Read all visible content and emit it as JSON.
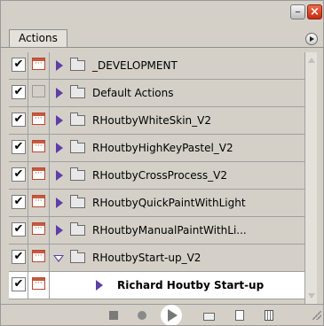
{
  "panel": {
    "tab_label": "Actions",
    "rows": [
      {
        "name": "_DEVELOPMENT",
        "checked": true,
        "dialog": true,
        "expanded": false,
        "kind": "set"
      },
      {
        "name": "Default Actions",
        "checked": true,
        "dialog": false,
        "expanded": false,
        "kind": "set"
      },
      {
        "name": "RHoutbyWhiteSkin_V2",
        "checked": true,
        "dialog": true,
        "expanded": false,
        "kind": "set"
      },
      {
        "name": "RHoutbyHighKeyPastel_V2",
        "checked": true,
        "dialog": true,
        "expanded": false,
        "kind": "set"
      },
      {
        "name": "RHoutbyCrossProcess_V2",
        "checked": true,
        "dialog": true,
        "expanded": false,
        "kind": "set"
      },
      {
        "name": "RHoutbyQuickPaintWithLight",
        "checked": true,
        "dialog": true,
        "expanded": false,
        "kind": "set"
      },
      {
        "name": "RHoutbyManualPaintWithLi...",
        "checked": true,
        "dialog": true,
        "expanded": false,
        "kind": "set"
      },
      {
        "name": "RHoutbyStart-up_V2",
        "checked": true,
        "dialog": true,
        "expanded": true,
        "kind": "set"
      },
      {
        "name": "Richard Houtby Start-up",
        "checked": true,
        "dialog": true,
        "expanded": false,
        "kind": "action",
        "selected": true
      }
    ]
  },
  "icons": {
    "check": "✔"
  },
  "colors": {
    "accent_arrow": "#5e3ea8",
    "dialog_red": "#c65a40",
    "close_red": "#d0401f"
  }
}
